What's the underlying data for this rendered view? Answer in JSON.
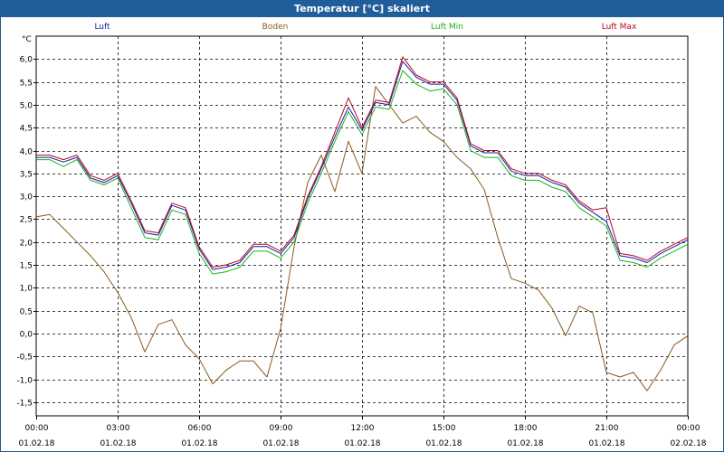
{
  "window": {
    "title": "Temperatur [°C] skaliert"
  },
  "colors": {
    "luft": "#1a1aa8",
    "boden": "#8a5a1e",
    "luft_min": "#18b418",
    "luft_max": "#b40a1e",
    "titlebar": "#1f5e9a"
  },
  "chart_data": {
    "type": "line",
    "title": "Temperatur [°C] skaliert",
    "ylabel": "°C",
    "xlabel": "",
    "ylim": [
      -1.8,
      6.5
    ],
    "xlim": [
      0,
      24
    ],
    "grid": true,
    "legend": "top",
    "y_ticks": [
      6.0,
      5.5,
      5.0,
      4.5,
      4.0,
      3.5,
      3.0,
      2.5,
      2.0,
      1.5,
      1.0,
      0.5,
      0.0,
      -0.5,
      -1.0,
      -1.5
    ],
    "y_tick_labels": [
      "6,0",
      "5,5",
      "5,0",
      "4,5",
      "4,0",
      "3,5",
      "3,0",
      "2,5",
      "2,0",
      "1,5",
      "1,0",
      "0,5",
      "0,0",
      "-0,5",
      "-1,0",
      "-1,5"
    ],
    "x_ticks": [
      {
        "x": 0,
        "time": "00:00",
        "date": "01.02.18"
      },
      {
        "x": 3,
        "time": "03:00",
        "date": "01.02.18"
      },
      {
        "x": 6,
        "time": "06:00",
        "date": "01.02.18"
      },
      {
        "x": 9,
        "time": "09:00",
        "date": "01.02.18"
      },
      {
        "x": 12,
        "time": "12:00",
        "date": "01.02.18"
      },
      {
        "x": 15,
        "time": "15:00",
        "date": "01.02.18"
      },
      {
        "x": 18,
        "time": "18:00",
        "date": "01.02.18"
      },
      {
        "x": 21,
        "time": "21:00",
        "date": "01.02.18"
      },
      {
        "x": 24,
        "time": "00:00",
        "date": "02.02.18"
      }
    ],
    "x": [
      0,
      0.5,
      1,
      1.5,
      2,
      2.5,
      3,
      3.5,
      4,
      4.5,
      5,
      5.5,
      6,
      6.5,
      7,
      7.5,
      8,
      8.5,
      9,
      9.5,
      10,
      10.5,
      11,
      11.5,
      12,
      12.5,
      13,
      13.5,
      14,
      14.5,
      15,
      15.5,
      16,
      16.5,
      17,
      17.5,
      18,
      18.5,
      19,
      19.5,
      20,
      20.5,
      21,
      21.5,
      22,
      22.5,
      23,
      23.5,
      24
    ],
    "series": [
      {
        "name": "Luft",
        "color": "#1a1aa8",
        "values": [
          3.85,
          3.85,
          3.75,
          3.85,
          3.4,
          3.3,
          3.45,
          2.85,
          2.2,
          2.15,
          2.8,
          2.7,
          1.85,
          1.4,
          1.45,
          1.55,
          1.9,
          1.9,
          1.75,
          2.1,
          2.95,
          3.6,
          4.3,
          4.95,
          4.45,
          5.05,
          5.0,
          5.95,
          5.6,
          5.45,
          5.45,
          5.1,
          4.1,
          3.95,
          3.95,
          3.55,
          3.45,
          3.45,
          3.3,
          3.2,
          2.85,
          2.65,
          2.45,
          1.7,
          1.65,
          1.55,
          1.75,
          1.9,
          2.05
        ]
      },
      {
        "name": "Boden",
        "color": "#8a5a1e",
        "values": [
          2.55,
          2.6,
          2.3,
          2.0,
          1.7,
          1.35,
          0.9,
          0.35,
          -0.4,
          0.2,
          0.3,
          -0.25,
          -0.55,
          -1.1,
          -0.8,
          -0.6,
          -0.6,
          -0.95,
          0.1,
          1.9,
          3.3,
          3.9,
          3.1,
          4.2,
          3.5,
          5.4,
          5.0,
          4.6,
          4.75,
          4.4,
          4.2,
          3.85,
          3.6,
          3.15,
          2.1,
          1.2,
          1.1,
          0.95,
          0.55,
          -0.05,
          0.6,
          0.45,
          -0.85,
          -0.95,
          -0.85,
          -1.25,
          -0.8,
          -0.25,
          -0.05
        ]
      },
      {
        "name": "Luft Min",
        "color": "#18b418",
        "values": [
          3.8,
          3.8,
          3.65,
          3.8,
          3.35,
          3.25,
          3.4,
          2.75,
          2.1,
          2.05,
          2.7,
          2.6,
          1.75,
          1.3,
          1.35,
          1.45,
          1.8,
          1.8,
          1.65,
          2.0,
          2.85,
          3.5,
          4.2,
          4.85,
          4.35,
          4.95,
          4.9,
          5.75,
          5.45,
          5.3,
          5.35,
          5.0,
          4.0,
          3.85,
          3.85,
          3.45,
          3.35,
          3.35,
          3.2,
          3.1,
          2.75,
          2.55,
          2.35,
          1.6,
          1.55,
          1.45,
          1.65,
          1.8,
          1.95
        ]
      },
      {
        "name": "Luft Max",
        "color": "#b40a1e",
        "values": [
          3.9,
          3.9,
          3.8,
          3.9,
          3.45,
          3.35,
          3.5,
          2.9,
          2.25,
          2.2,
          2.85,
          2.75,
          1.9,
          1.45,
          1.5,
          1.6,
          1.95,
          1.95,
          1.8,
          2.15,
          3.0,
          3.65,
          4.4,
          5.15,
          4.5,
          5.1,
          5.05,
          6.05,
          5.65,
          5.5,
          5.5,
          5.15,
          4.15,
          4.0,
          4.0,
          3.6,
          3.5,
          3.5,
          3.35,
          3.25,
          2.9,
          2.7,
          2.75,
          1.75,
          1.7,
          1.6,
          1.8,
          1.95,
          2.1
        ]
      }
    ]
  }
}
